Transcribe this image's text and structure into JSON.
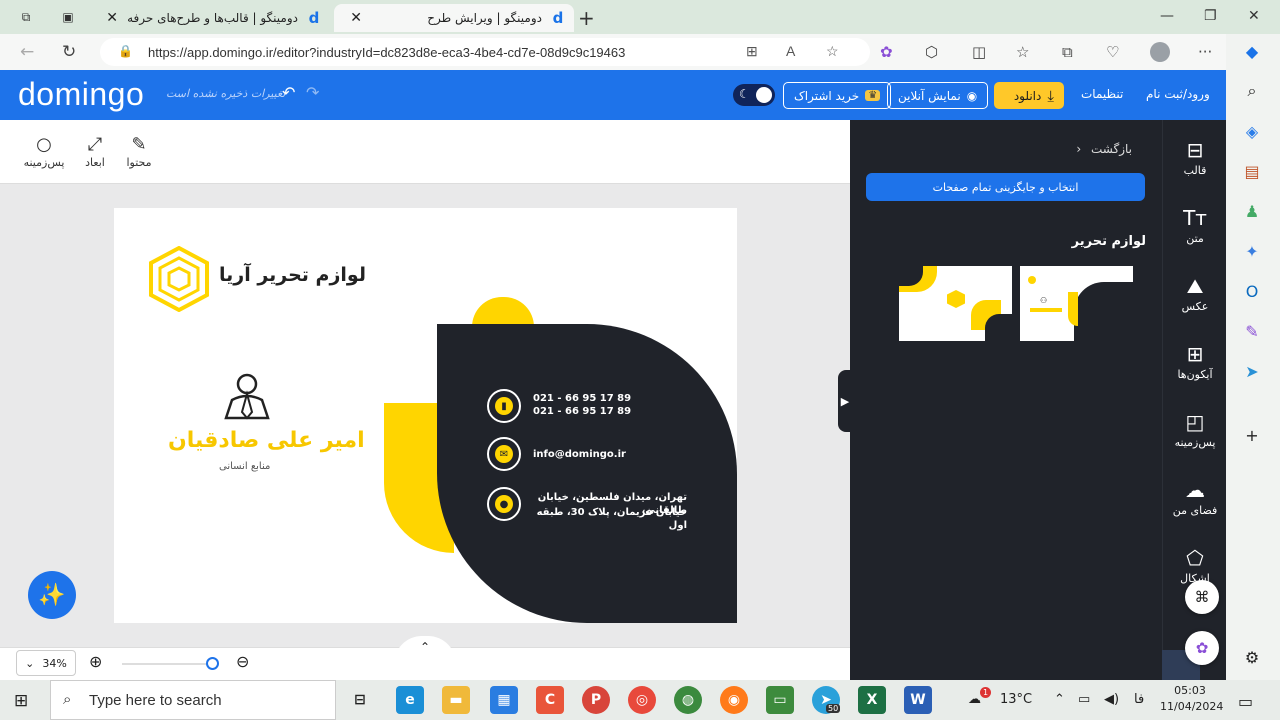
{
  "browser": {
    "tabs": [
      {
        "title": "دومینگو | قالب‌ها و طرح‌های حرفه‌",
        "active": false
      },
      {
        "title": "دومینگو | ویرایش طرح",
        "active": true
      }
    ],
    "url": "https://app.domingo.ir/editor?industryId=dc823d8e-eca3-4be4-cd7e-08d9c9c19463"
  },
  "app": {
    "logo": "domingo",
    "save_status": "تغییرات ذخیره نشده است",
    "header": {
      "buy_subscription": "خرید اشتراک",
      "online_preview": "نمایش آنلاین",
      "download": "دانلود",
      "settings": "تنظیمات",
      "login": "ورود/ثبت نام"
    },
    "toolbar": {
      "content": "محتوا",
      "dimensions": "ابعاد",
      "background": "پس‌زمینه"
    },
    "zoom": "34%",
    "side_panel": {
      "back": "بازگشت",
      "select_all": "انتخاب و جایگزینی تمام صفحات",
      "category_title": "لوازم تحریر"
    },
    "rail": [
      {
        "label": "قالب",
        "icon": "template-icon"
      },
      {
        "label": "متن",
        "icon": "text-icon"
      },
      {
        "label": "عکس",
        "icon": "image-icon"
      },
      {
        "label": "آیکون‌ها",
        "icon": "icons-grid-icon"
      },
      {
        "label": "پس‌زمینه",
        "icon": "background-icon"
      },
      {
        "label": "فضای من",
        "icon": "cloud-upload-icon"
      },
      {
        "label": "اشکال",
        "icon": "shapes-icon"
      }
    ]
  },
  "card": {
    "brand": "لوازم تحریر آریا",
    "person_name": "امیر علی صادقیان",
    "role": "منابع انسانی",
    "phone_1": "021 - 66 95 17 89",
    "phone_2": "021 - 66 95 17 89",
    "email": "info@domingo.ir",
    "address_1": "تهران، میدان فلسطین، خیابان طالقانی،",
    "address_2": "خیابان فریمان، پلاک 30، طبقه اول",
    "accent_color": "#ffd500",
    "dark_color": "#20232a"
  },
  "taskbar": {
    "search_placeholder": "Type here to search",
    "weather": "13°C",
    "lang": "فا",
    "time": "05:03",
    "date": "11/04/2024",
    "telegram_badge": "50",
    "notification_badge": "1"
  },
  "colors": {
    "brand_blue": "#1e73ea",
    "download_yellow": "#ffc829",
    "panel_dark": "#20232a"
  }
}
